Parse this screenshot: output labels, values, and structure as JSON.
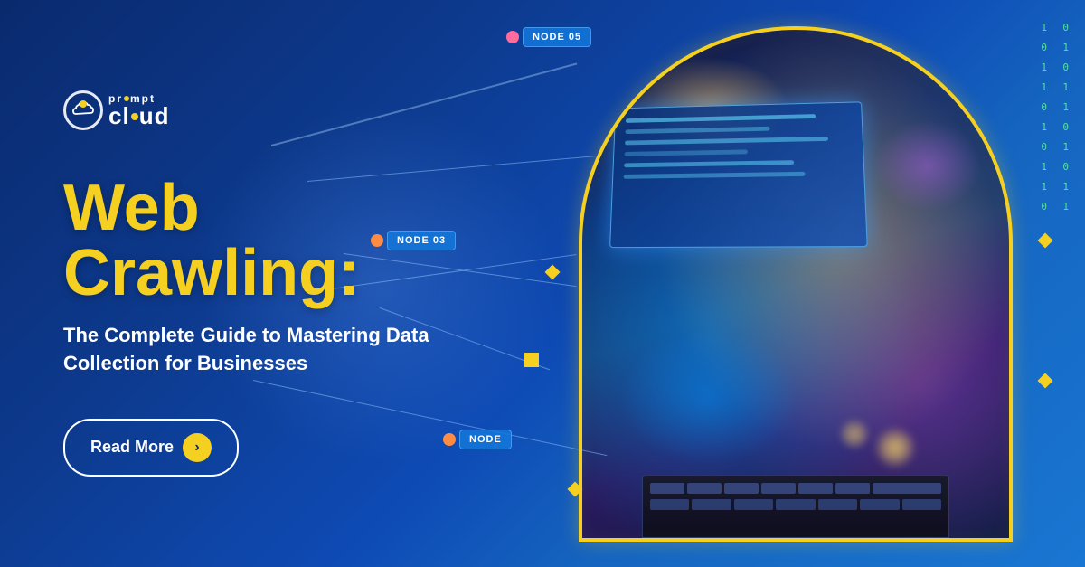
{
  "brand": {
    "name": "PromptCloud",
    "logo_prompt_text": "pr•mpt",
    "logo_cloud_text": "cloud"
  },
  "hero": {
    "title_line1": "Web",
    "title_line2": "Crawling:",
    "subtitle": "The Complete Guide to Mastering Data Collection for Businesses",
    "cta_button": "Read More",
    "cta_arrow": "›"
  },
  "nodes": [
    {
      "id": "node-05",
      "label": "NODE 05",
      "color": "pink"
    },
    {
      "id": "node-03",
      "label": "NODE 03",
      "color": "orange"
    },
    {
      "id": "node-bottom",
      "label": "NODE",
      "color": "orange"
    }
  ],
  "binary": {
    "col1": "1\n0\n1\n1\n0\n1\n0\n1\n1\n0",
    "col2": "0\n1\n0\n1\n1\n0\n1\n0\n1\n1"
  },
  "colors": {
    "accent_yellow": "#f5d020",
    "bg_dark_blue": "#0a2a6e",
    "bg_mid_blue": "#0d3a8e",
    "text_white": "#ffffff",
    "button_border": "#ffffff"
  }
}
